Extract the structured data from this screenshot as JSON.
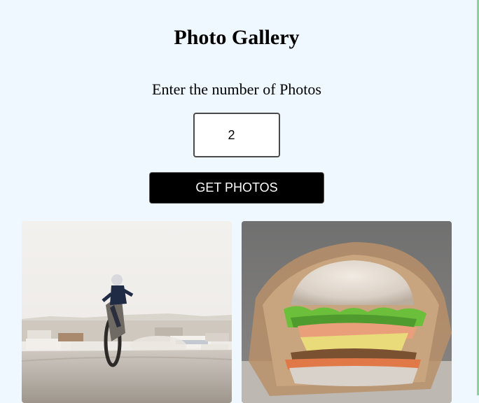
{
  "page": {
    "title": "Photo Gallery",
    "prompt": "Enter the number of Photos"
  },
  "form": {
    "count_value": "2",
    "submit_label": "GET PHOTOS"
  },
  "gallery": {
    "photos": [
      {
        "subject": "motocross rider performing a wheelie on a dusty dirt road"
      },
      {
        "subject": "veggie burger with lettuce, cheese and sauce in a paper wrap"
      }
    ]
  },
  "colors": {
    "background": "#f0f8ff",
    "button_bg": "#000000",
    "button_text": "#ffffff"
  }
}
